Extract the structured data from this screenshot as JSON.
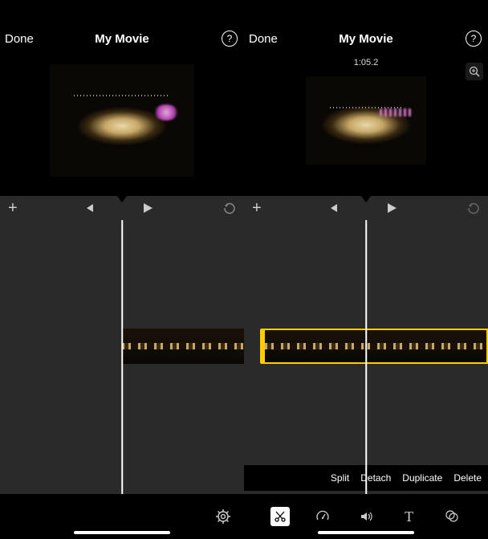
{
  "left": {
    "done": "Done",
    "title": "My Movie",
    "help": "?"
  },
  "right": {
    "done": "Done",
    "title": "My Movie",
    "help": "?",
    "timecode": "1:05.2",
    "actions": {
      "split": "Split",
      "detach": "Detach",
      "duplicate": "Duplicate",
      "delete": "Delete"
    },
    "tools": {
      "cut": "cut-icon",
      "speed": "speed-icon",
      "volume": "volume-icon",
      "text": "text-icon",
      "filters": "filters-icon"
    }
  },
  "icons": {
    "add": "+",
    "gear": "gear-icon",
    "text_glyph": "T"
  }
}
